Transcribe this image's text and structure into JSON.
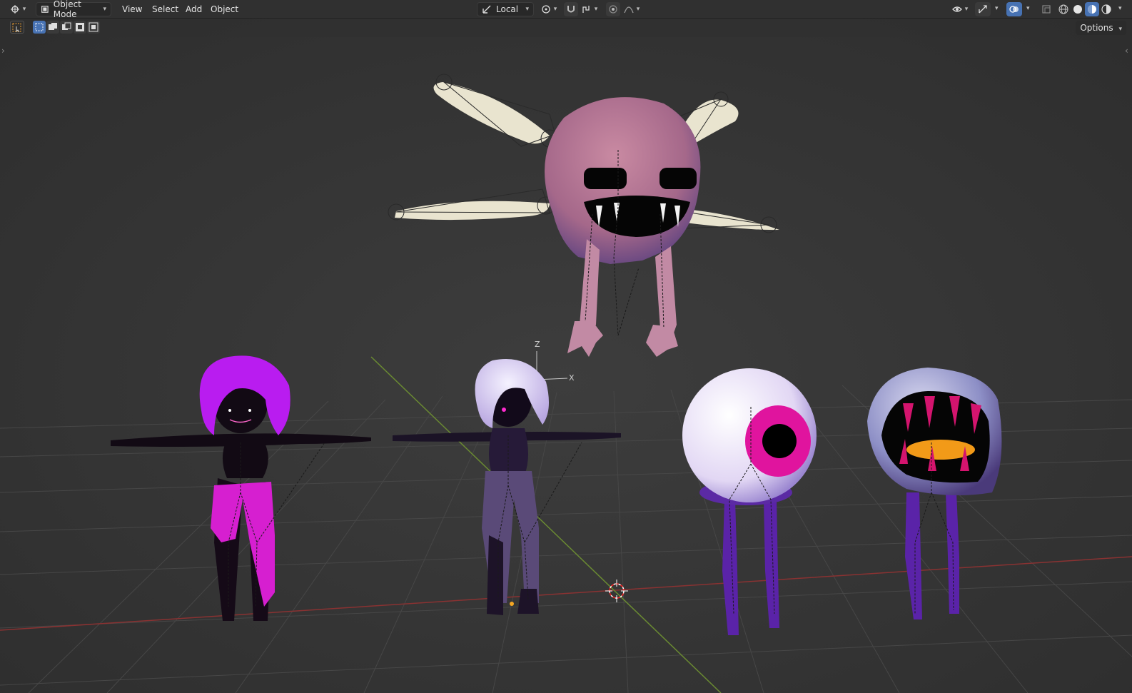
{
  "header": {
    "editor_type_icon": "editor-type-icon",
    "mode": {
      "icon": "object-mode-icon",
      "label": "Object Mode"
    },
    "menus": [
      "View",
      "Select",
      "Add",
      "Object"
    ],
    "transform_orientation": {
      "icon": "transform-orientation-icon",
      "label": "Local"
    },
    "pivot_icon": "pivot-point-icon",
    "snap_icon": "snap-magnet-icon",
    "snap_target_icon": "snap-increment-icon",
    "proportional_icon": "proportional-edit-icon",
    "falloff_icon": "falloff-curve-icon",
    "right_icons": [
      "visibility-eye-icon",
      "gizmo-icon",
      "overlays-icon",
      "xray-icon",
      "wireframe-shading-icon",
      "solid-shading-icon",
      "material-shading-icon",
      "rendered-shading-icon"
    ]
  },
  "tool_settings": {
    "tool_icon": "select-box-tool-icon",
    "selection_modes": [
      "new-selection-icon",
      "extend-selection-icon",
      "subtract-selection-icon",
      "invert-selection-icon",
      "intersect-selection-icon"
    ],
    "options_label": "Options"
  },
  "viewport": {
    "gizmo_axes": {
      "z": "Z",
      "x": "X"
    },
    "colors": {
      "background": "#393939",
      "grid": "#444444",
      "x_axis": "#7a2e2e",
      "y_axis": "#5a7a2a"
    }
  },
  "objects": [
    {
      "name": "flying-ghost-creature",
      "color": "#b8748f"
    },
    {
      "name": "magenta-hair-girl",
      "color": "#c41bd6"
    },
    {
      "name": "white-hair-girl",
      "color": "#d8c8f0"
    },
    {
      "name": "eyeball-creature",
      "color": "#e4dcf4"
    },
    {
      "name": "mouth-creature",
      "color": "#8f8fc8"
    }
  ]
}
